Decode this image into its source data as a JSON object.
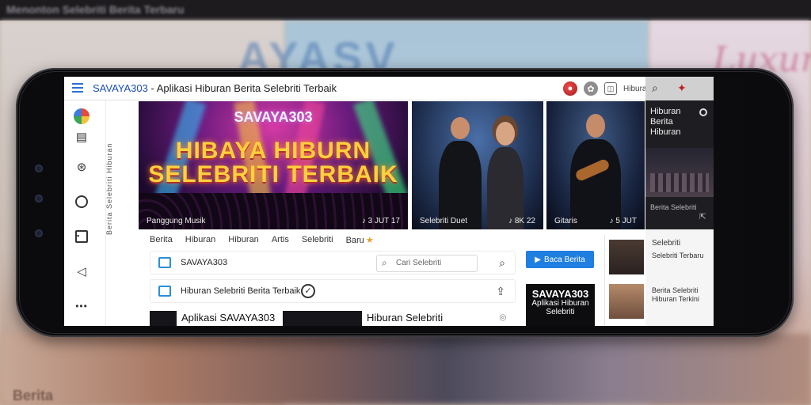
{
  "background": {
    "top_text": "Menonton Selebriti Berita Terbaru",
    "big_word": "AYASV",
    "script_word": "Luxuri",
    "bottom_text": "Berita"
  },
  "app": {
    "brand": "SAVAYA303",
    "title_rest": " - Aplikasi Hiburan Berita Selebriti Terbaik",
    "top_label": "Hiburan"
  },
  "rail": {
    "vertical_label": "Berita Selebriti Hiburan"
  },
  "banner1": {
    "brand": "SAVAYA303",
    "headline_line1": "HIBAYA HIBURN",
    "headline_line2": "SELEBRITI TERBAIK",
    "caption_left": "Panggung Musik",
    "caption_right": "♪ 3 JUT 17"
  },
  "banner2": {
    "caption_left": "Selebriti Duet",
    "caption_right": "♪ 8K 22"
  },
  "banner3": {
    "caption_left": "Gitaris",
    "caption_right": "♪ 5 JUT"
  },
  "side_panel": {
    "title": "Hiburan Berita Hiburan",
    "caption": "Berita Selebriti",
    "text1": "Selebriti",
    "text2": "Selebriti Terbaru",
    "text3": "Berita Selebriti Hiburan Terkini"
  },
  "tabs": [
    "Berita",
    "Hiburan",
    "Hiburan",
    "Artis",
    "Selebriti",
    "Baru"
  ],
  "rows": {
    "row1_text": "SAVAYA303",
    "search_placeholder": "Cari Selebriti",
    "row2_text": "Hiburan Selebriti Berita Terbaik"
  },
  "blue_button": {
    "label": "Baca Berita"
  },
  "promo": {
    "line1": "SAVAYA303",
    "line2": "Aplikasi Hiburan",
    "line3": "Selebriti"
  },
  "bottom": {
    "left_text": "Aplikasi SAVAYA303",
    "right_text": "Hiburan Selebriti"
  },
  "colors": {
    "accent": "#1f7fe0",
    "brand": "#1b4fb6",
    "headline": "#ffd03c"
  }
}
